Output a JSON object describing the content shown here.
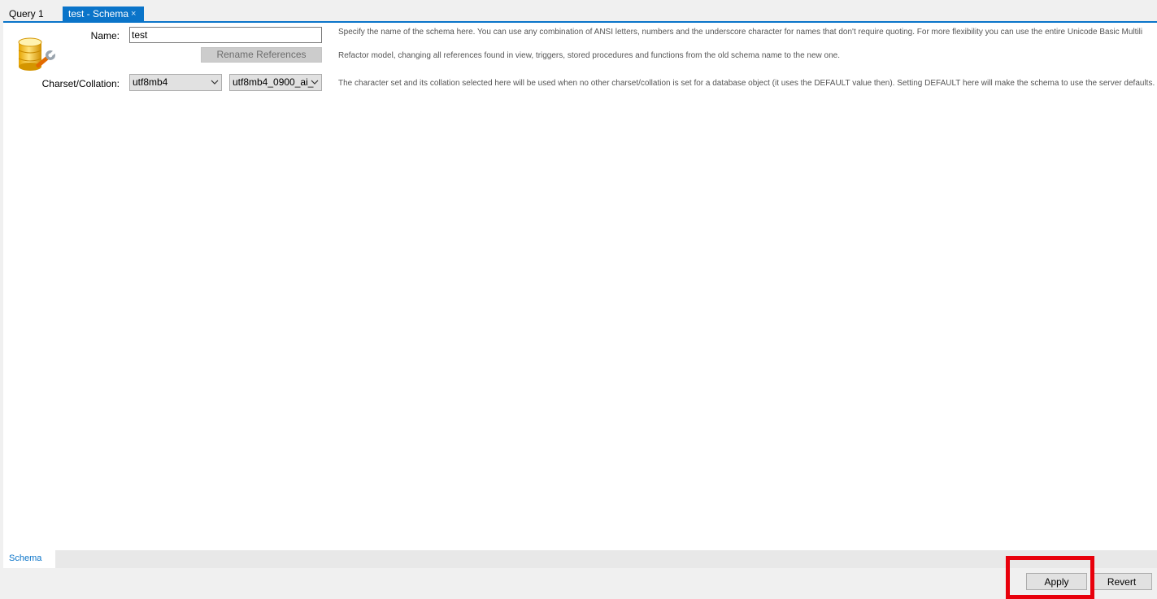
{
  "tabs": [
    {
      "label": "Query 1",
      "active": false
    },
    {
      "label": "test - Schema",
      "active": true,
      "close_glyph": "×"
    }
  ],
  "form": {
    "name_label": "Name:",
    "name_value": "test",
    "rename_button_label": "Rename References",
    "charset_label": "Charset/Collation:",
    "charset_value": "utf8mb4",
    "collation_value": "utf8mb4_0900_ai_"
  },
  "descriptions": {
    "name": "Specify the name of the schema here. You can use any combination of ANSI letters, numbers and the underscore character for names that don't require quoting. For more flexibility you can use the entire Unicode Basic Multili",
    "rename": "Refactor model, changing all references found in view, triggers, stored procedures and functions from the old schema name to the new one.",
    "charset": "The character set and its collation selected here will be used when no other charset/collation is set for a database object (it uses the DEFAULT value then). Setting DEFAULT here will make the schema to use the server defaults."
  },
  "bottom_tabs": [
    {
      "label": "Schema",
      "active": true
    }
  ],
  "actions": {
    "apply_label": "Apply",
    "revert_label": "Revert"
  },
  "icons": {
    "schema": "database-wrench-icon",
    "dropdown": "chevron-down-icon"
  },
  "colors": {
    "accent": "#0a74c9",
    "highlight": "#e8000b"
  }
}
